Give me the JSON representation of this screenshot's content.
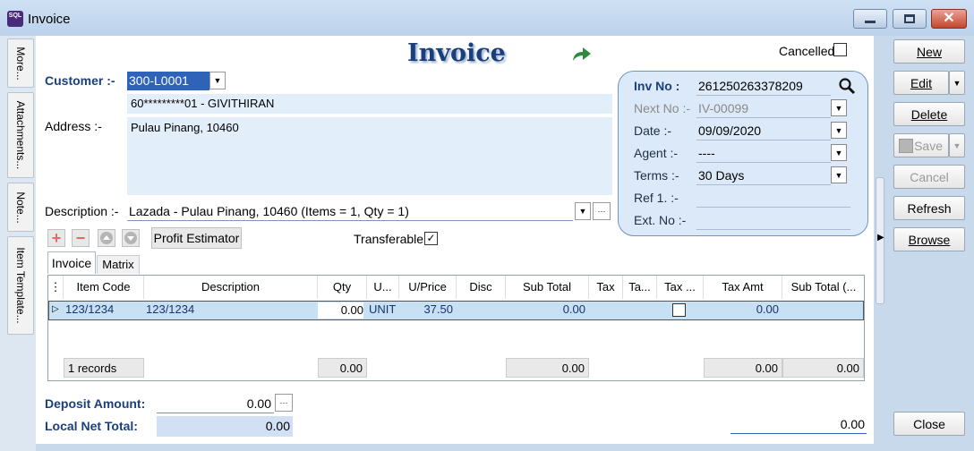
{
  "window": {
    "title": "Invoice",
    "app_icon_text": "SQL"
  },
  "left_tabs": [
    "More...",
    "Attachments...",
    "Note...",
    "Item Template..."
  ],
  "header": {
    "title": "Invoice",
    "cancelled_label": "Cancelled"
  },
  "customer": {
    "label": "Customer :-",
    "code": "300-L0001",
    "name_line": "60*********01 - GIVITHIRAN",
    "address_label": "Address :-",
    "address": "Pulau Pinang, 10460",
    "description_label": "Description :-",
    "description": "Lazada - Pulau Pinang, 10460 (Items = 1, Qty = 1)"
  },
  "info": {
    "inv_no_label": "Inv No :",
    "inv_no": "261250263378209",
    "next_no_label": "Next No :-",
    "next_no": "IV-00099",
    "date_label": "Date :-",
    "date": "09/09/2020",
    "agent_label": "Agent :-",
    "agent": "----",
    "terms_label": "Terms :-",
    "terms": "30 Days",
    "ref1_label": "Ref 1. :-",
    "ref1": "",
    "ext_no_label": "Ext. No :-",
    "ext_no": ""
  },
  "toolbar": {
    "profit_estimator": "Profit Estimator",
    "transferable_label": "Transferable",
    "transferable_checked": true
  },
  "tabs": [
    "Invoice",
    "Matrix"
  ],
  "grid": {
    "columns": [
      "Item Code",
      "Description",
      "Qty",
      "U...",
      "U/Price",
      "Disc",
      "Sub Total",
      "Tax",
      "Ta...",
      "Tax ...",
      "Tax Amt",
      "Sub Total (..."
    ],
    "rows": [
      {
        "item_code": "123/1234",
        "description": "123/1234",
        "qty": "0.00",
        "uom": "UNIT",
        "uprice": "37.50",
        "disc": "",
        "sub_total": "0.00",
        "tax": "",
        "tax_rate": "",
        "tax_inclusive": false,
        "tax_amt": "0.00",
        "sub_total_tax": ""
      }
    ],
    "footer": {
      "records": "1 records",
      "qty": "0.00",
      "sub_total": "0.00",
      "tax_amt": "0.00",
      "sub_total_tax": "0.00"
    }
  },
  "totals": {
    "deposit_label": "Deposit Amount:",
    "deposit": "0.00",
    "local_net_label": "Local Net Total:",
    "local_net": "0.00",
    "net_total": "0.00"
  },
  "actions": {
    "new": "New",
    "edit": "Edit",
    "delete": "Delete",
    "save": "Save",
    "cancel": "Cancel",
    "refresh": "Refresh",
    "browse": "Browse",
    "close": "Close"
  },
  "colors": {
    "accent": "#1a3f7c",
    "field_bg": "#e3eefb",
    "panel_bg": "#dce9f8",
    "selected": "#2e63b8"
  }
}
